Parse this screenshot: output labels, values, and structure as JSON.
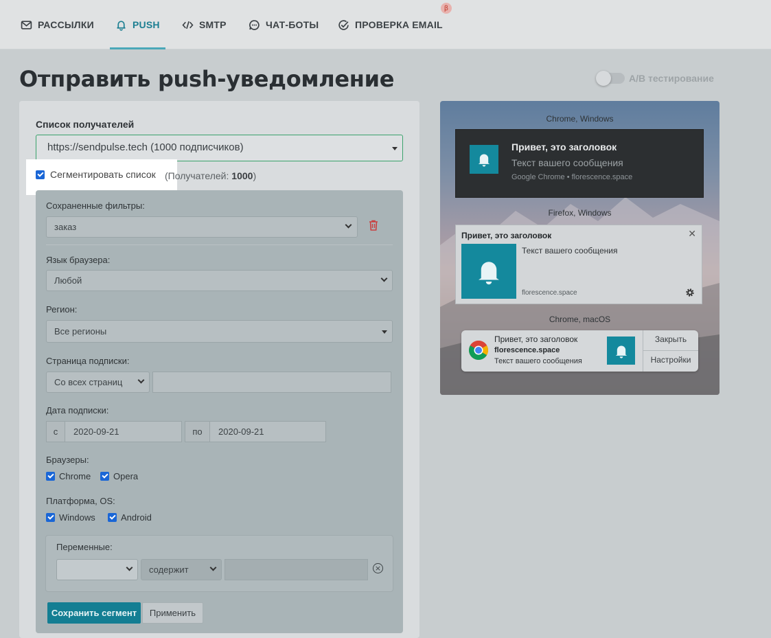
{
  "nav": {
    "tabs": [
      {
        "label": "РАССЫЛКИ",
        "icon": "mail-icon"
      },
      {
        "label": "PUSH",
        "icon": "bell-icon",
        "active": true
      },
      {
        "label": "SMTP",
        "icon": "code-icon"
      },
      {
        "label": "ЧАТ-БОТЫ",
        "icon": "chat-icon"
      },
      {
        "label": "ПРОВЕРКА EMAIL",
        "icon": "check-circle-icon"
      }
    ],
    "beta_badge": "β"
  },
  "page_title": "Отправить push-уведомление",
  "ab_testing_label": "А/В тестирование",
  "recipients": {
    "label": "Список получателей",
    "selected": "https://sendpulse.tech (1000 подписчиков)",
    "segment_label": "Сегментировать список",
    "segment_count_prefix": "(Получателей: ",
    "segment_count": "1000",
    "segment_count_suffix": ")"
  },
  "filters": {
    "saved_filters_label": "Сохраненные фильтры:",
    "saved_filter_value": "заказ",
    "browser_language_label": "Язык браузера:",
    "browser_language_value": "Любой",
    "region_label": "Регион:",
    "region_value": "Все регионы",
    "subscription_page_label": "Страница подписки:",
    "subscription_page_value": "Со всех страниц",
    "subscription_page_input": "",
    "subscription_date_label": "Дата подписки:",
    "date_from_prefix": "с",
    "date_from": "2020-09-21",
    "date_to_prefix": "по",
    "date_to": "2020-09-21",
    "browsers_label": "Браузеры:",
    "browsers": [
      "Chrome",
      "Opera"
    ],
    "platform_label": "Платформа, OS:",
    "platforms": [
      "Windows",
      "Android"
    ],
    "variables_label": "Переменные:",
    "variable_value": "",
    "variable_operator": "содержит",
    "variable_input": "",
    "save_segment_label": "Сохранить сегмент",
    "apply_label": "Применить"
  },
  "preview": {
    "chrome_windows_label": "Chrome, Windows",
    "firefox_windows_label": "Firefox, Windows",
    "chrome_macos_label": "Chrome, macOS",
    "title": "Привет, это заголовок",
    "message": "Текст вашего сообщения",
    "chrome_source": "Google Chrome • florescence.space",
    "domain": "florescence.space",
    "close_label": "Закрыть",
    "settings_label": "Настройки",
    "accent_color": "#14899d"
  }
}
